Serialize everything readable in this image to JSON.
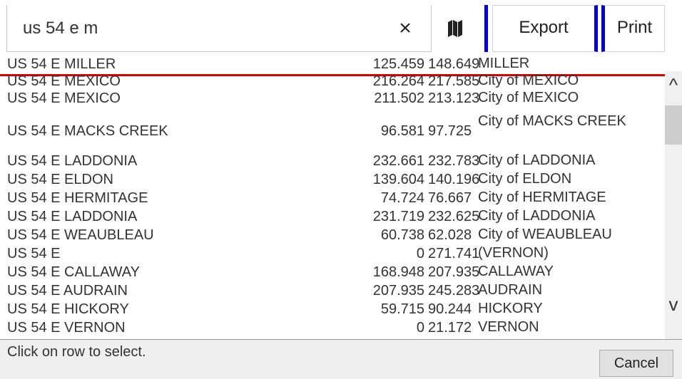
{
  "search": {
    "value": "us 54 e m",
    "clear_label": "×"
  },
  "toolbar": {
    "map_icon": "map-icon",
    "export_label": "Export",
    "print_label": "Print",
    "accent": "#0000ee"
  },
  "results": {
    "rows": [
      {
        "road": "US 54 E MILLER",
        "from": "125.459",
        "to": "148.649",
        "area": "MILLER",
        "selected": true
      },
      {
        "road": "US 54 E MEXICO",
        "from": "216.264",
        "to": "217.585",
        "area": "City of MEXICO"
      },
      {
        "road": "US 54 E MEXICO",
        "from": "211.502",
        "to": "213.123",
        "area": "City of MEXICO"
      },
      {
        "road": "US 54 E MACKS CREEK",
        "from": "96.581",
        "to": "97.725",
        "area": "City of MACKS CREEK"
      },
      {
        "road": "US 54 E LADDONIA",
        "from": "232.661",
        "to": "232.783",
        "area": "City of LADDONIA"
      },
      {
        "road": "US 54 E ELDON",
        "from": "139.604",
        "to": "140.196",
        "area": "City of ELDON"
      },
      {
        "road": "US 54 E HERMITAGE",
        "from": "74.724",
        "to": "76.667",
        "area": "City of HERMITAGE"
      },
      {
        "road": "US 54 E LADDONIA",
        "from": "231.719",
        "to": "232.625",
        "area": "City of LADDONIA"
      },
      {
        "road": "US 54 E WEAUBLEAU",
        "from": "60.738",
        "to": "62.028",
        "area": "City of WEAUBLEAU"
      },
      {
        "road": "US 54 E",
        "from": "0",
        "to": "271.741",
        "area": "(VERNON)"
      },
      {
        "road": "US 54 E CALLAWAY",
        "from": "168.948",
        "to": "207.935",
        "area": "CALLAWAY"
      },
      {
        "road": "US 54 E AUDRAIN",
        "from": "207.935",
        "to": "245.283",
        "area": "AUDRAIN"
      },
      {
        "road": "US 54 E HICKORY",
        "from": "59.715",
        "to": "90.244",
        "area": "HICKORY"
      },
      {
        "road": "US 54 E VERNON",
        "from": "0",
        "to": "21.172",
        "area": "VERNON"
      }
    ],
    "selected_outline_color": "#e00000"
  },
  "scrollbar": {
    "up_icon": "chevron-up-icon",
    "down_icon": "chevron-down-icon",
    "up_glyph": "^",
    "down_glyph": "v"
  },
  "footer": {
    "status": "Click on row to select.",
    "cancel_label": "Cancel"
  }
}
